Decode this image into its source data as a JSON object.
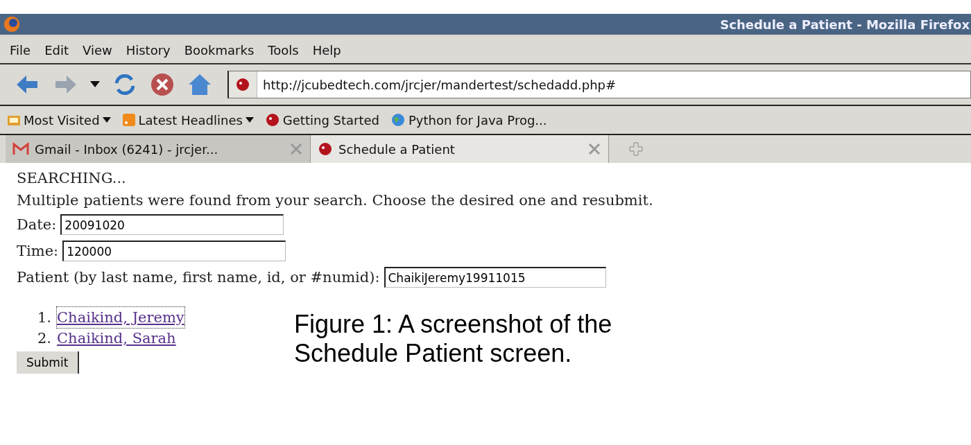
{
  "window": {
    "title": "Schedule a Patient - Mozilla Firefox"
  },
  "menu": [
    "File",
    "Edit",
    "View",
    "History",
    "Bookmarks",
    "Tools",
    "Help"
  ],
  "address": {
    "value": "http://jcubedtech.com/jrcjer/mandertest/schedadd.php#"
  },
  "bookmarks": [
    {
      "label": "Most Visited",
      "kind": "folder",
      "dropdown": true
    },
    {
      "label": "Latest Headlines",
      "kind": "feed",
      "dropdown": true
    },
    {
      "label": "Getting Started",
      "kind": "site",
      "dropdown": false
    },
    {
      "label": "Python for Java Prog...",
      "kind": "globe",
      "dropdown": false
    }
  ],
  "tabs": [
    {
      "label": "Gmail - Inbox (6241) - jrcjer...",
      "kind": "mail",
      "selected": false
    },
    {
      "label": "Schedule a Patient",
      "kind": "site",
      "selected": true
    }
  ],
  "page": {
    "status": "SEARCHING...",
    "message": "Multiple patients were found from your search. Choose the desired one and resubmit.",
    "fields": [
      {
        "label": "Date:",
        "value": "20091020",
        "kind": "short"
      },
      {
        "label": "Time:",
        "value": "120000",
        "kind": "short"
      },
      {
        "label": "Patient (by last name, first name, id, or #numid):",
        "value": "ChaikiJeremy19911015",
        "kind": "long"
      }
    ],
    "results": [
      {
        "number": "1.",
        "name": "Chaikind, Jeremy",
        "focused": true
      },
      {
        "number": "2.",
        "name": "Chaikind, Sarah",
        "focused": false
      }
    ],
    "submit": "Submit"
  },
  "caption": "Figure 1: A screenshot of the Schedule Patient screen."
}
